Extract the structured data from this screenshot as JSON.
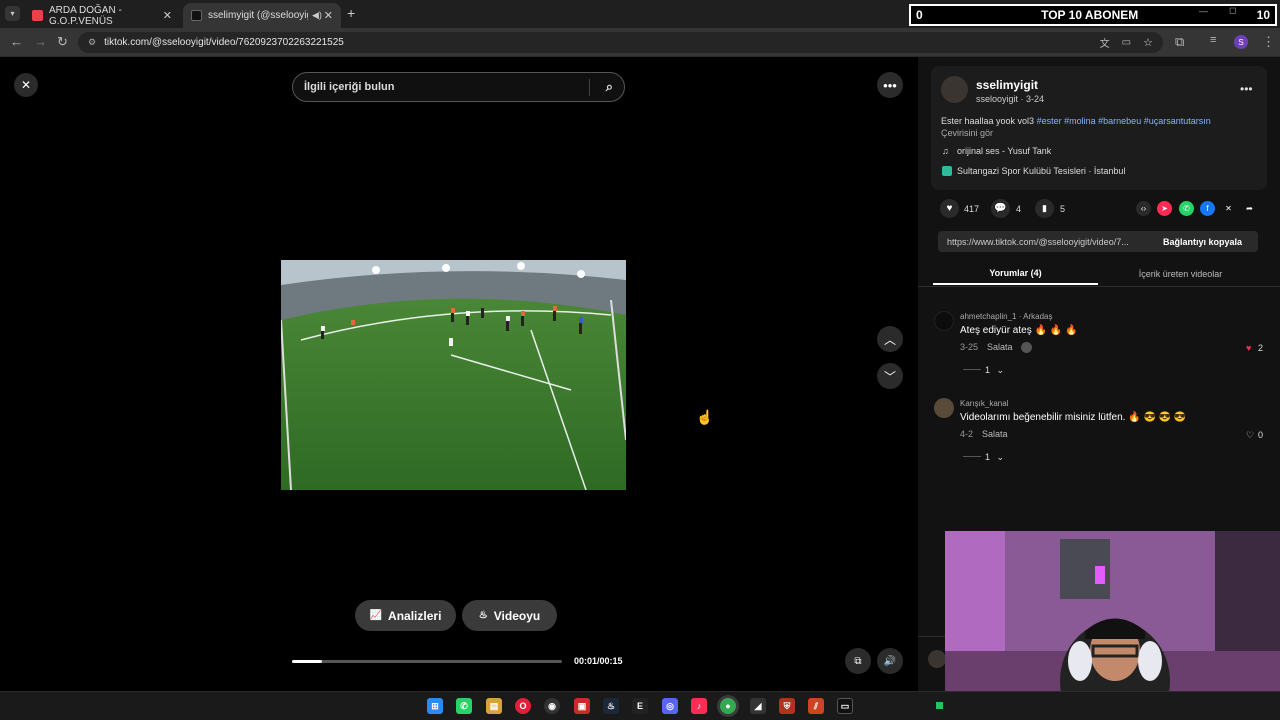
{
  "browser": {
    "tabs": [
      {
        "label": "ARDA DOĞAN - G.O.P.VENÜS",
        "favicon_color": "#e8414b"
      },
      {
        "label": "sselimyigit (@sselooyigit) |",
        "favicon_color": "#000000"
      }
    ],
    "new_tab": "+",
    "url": "tiktok.com/@sselooyigit/video/7620923702263221525"
  },
  "stream_overlay": {
    "left": "0",
    "title": "TOP 10 ABONEM",
    "right": "10"
  },
  "player": {
    "search_placeholder": "İlgili içeriği bulun",
    "analytics_button": "Analizleri",
    "promote_button": "Videoyu",
    "time": "00:01/00:15",
    "progress": 0.11
  },
  "post": {
    "display_name": "sselimyigit",
    "handle_date": "sselooyigit · 3-24",
    "caption_text": "Ester haallaa yook vol3",
    "hashtags": [
      "#ester",
      "#molina",
      "#barnebeu",
      "#uçarsantutarsın"
    ],
    "translate": "Çevirisini gör",
    "sound": "orijinal ses - Yusuf Tank",
    "location": "Sultangazi Spor Kulübü Tesisleri · İstanbul",
    "likes": "417",
    "comments": "4",
    "saves": "5",
    "link": "https://www.tiktok.com/@sselooyigit/video/7...",
    "copy_link": "Bağlantıyı kopyala",
    "tab_comments": "Yorumlar (4)",
    "tab_creator": "İçerik üreten videolar"
  },
  "comments": [
    {
      "user": "ahmetchaplin_1 · Arkadaş",
      "text": "Ateş ediyür ateş 🔥 🔥 🔥",
      "date": "3-25",
      "badge": "Salata",
      "likes": "2",
      "replies": "1"
    },
    {
      "user": "Karışık_kanal",
      "text": "Videolarımı beğenebilir misiniz lütfen. 🔥 😎 😎 😎",
      "date": "4-2",
      "badge": "Salata",
      "likes": "0",
      "replies": "1"
    }
  ]
}
